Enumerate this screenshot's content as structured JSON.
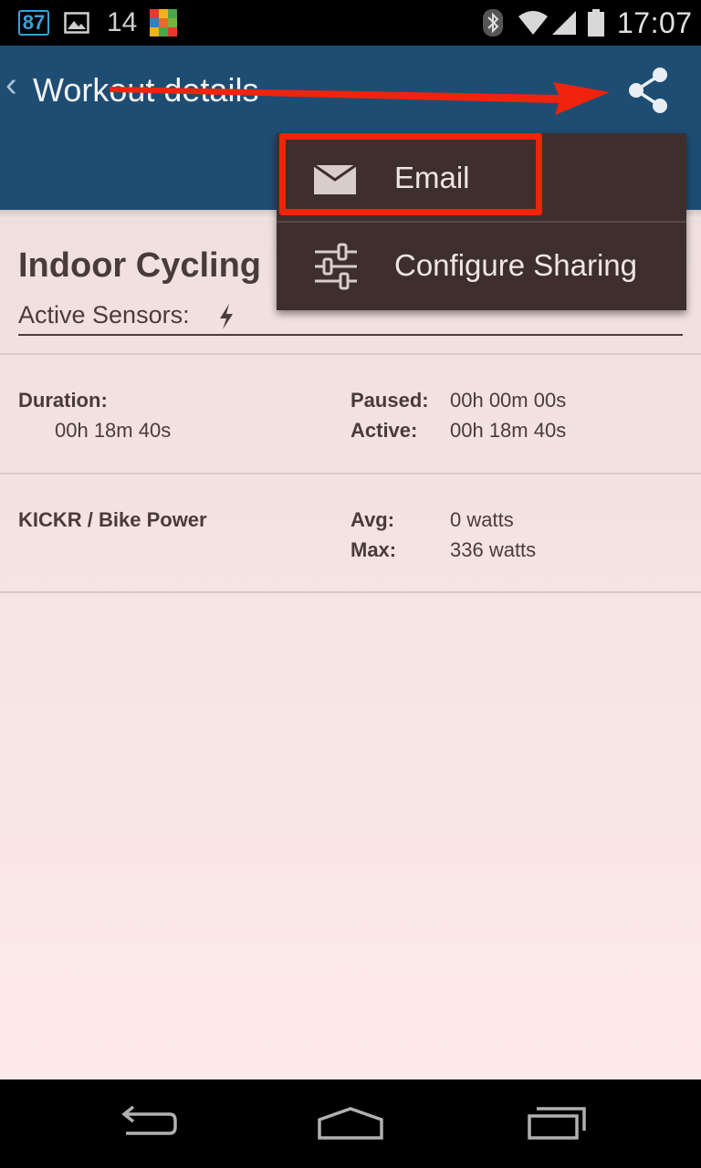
{
  "status_bar": {
    "badge": "87",
    "notification_count": "14",
    "time": "17:07",
    "icons": [
      "image-icon",
      "app-tile-icon",
      "bluetooth-icon",
      "wifi-icon",
      "signal-icon",
      "battery-icon"
    ]
  },
  "app_bar": {
    "back_icon": "chevron-left-icon",
    "title": "Workout details",
    "share_icon": "share-icon",
    "color": "#1e4d74"
  },
  "menu": {
    "items": [
      {
        "label": "Email",
        "icon": "envelope-icon"
      },
      {
        "label": "Configure Sharing",
        "icon": "sliders-icon"
      }
    ],
    "background": "#3e2f2d",
    "highlight_color": "#f0230c"
  },
  "workout": {
    "title": "Indoor Cycling",
    "sensors_label": "Active Sensors:",
    "sensor_icon": "bolt-icon",
    "duration": {
      "label": "Duration:",
      "value": "00h 18m 40s",
      "paused_label": "Paused:",
      "paused_value": "00h 00m 00s",
      "active_label": "Active:",
      "active_value": "00h 18m 40s"
    },
    "power": {
      "label": "KICKR / Bike Power",
      "avg_label": "Avg:",
      "avg_value": "0 watts",
      "max_label": "Max:",
      "max_value": "336 watts"
    }
  },
  "nav_bar": {
    "icons": [
      "back-icon",
      "home-icon",
      "recent-apps-icon"
    ]
  }
}
